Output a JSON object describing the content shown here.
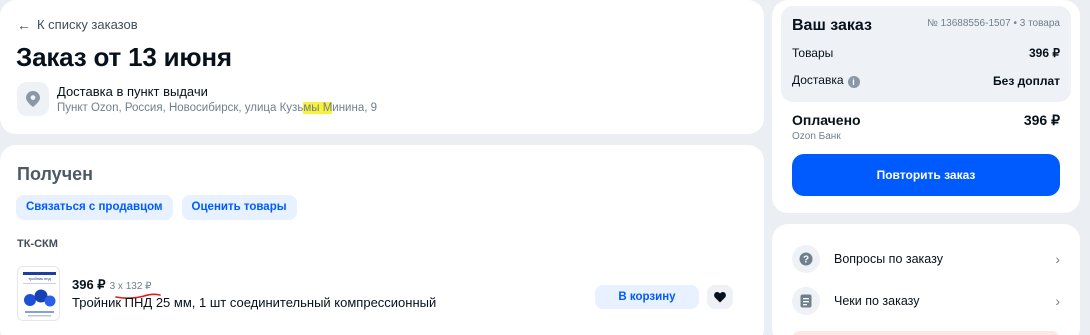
{
  "order": {
    "back_label": "К списку заказов",
    "title": "Заказ от 13 июня",
    "delivery_type": "Доставка в пункт выдачи",
    "address_before": "Пункт Ozon, Россия, Новосибирск, улица Кузь",
    "address_highlight": "мы М",
    "address_after": "инина, 9"
  },
  "status": {
    "title": "Получен",
    "contact_seller": "Связаться с продавцом",
    "rate_items": "Оценить товары",
    "seller": "ТК-СКМ"
  },
  "item": {
    "price": "396 ₽",
    "qty_price": "3 x 132 ₽",
    "name": "Тройник ПНД 25 мм, 1 шт соединительный компрессионный",
    "thumb_caption": "тройник пнд",
    "add_to_cart": "В корзину"
  },
  "summary": {
    "title": "Ваш заказ",
    "order_number": "№ 13688556-1507 • 3 товара",
    "goods_label": "Товары",
    "goods_value": "396 ₽",
    "delivery_label": "Доставка",
    "delivery_value": "Без доплат",
    "paid_label": "Оплачено",
    "paid_value": "396 ₽",
    "bank": "Ozon Банк",
    "repeat_button": "Повторить заказ"
  },
  "links": [
    {
      "label": "Вопросы по заказу",
      "icon": "question-icon"
    },
    {
      "label": "Чеки по заказу",
      "icon": "receipt-icon"
    }
  ],
  "colors": {
    "accent": "#005bff",
    "chip_bg": "#e7f1ff",
    "page_bg": "#ebeef3",
    "highlight": "#f8f23a",
    "annotation_red": "#e0191e"
  }
}
